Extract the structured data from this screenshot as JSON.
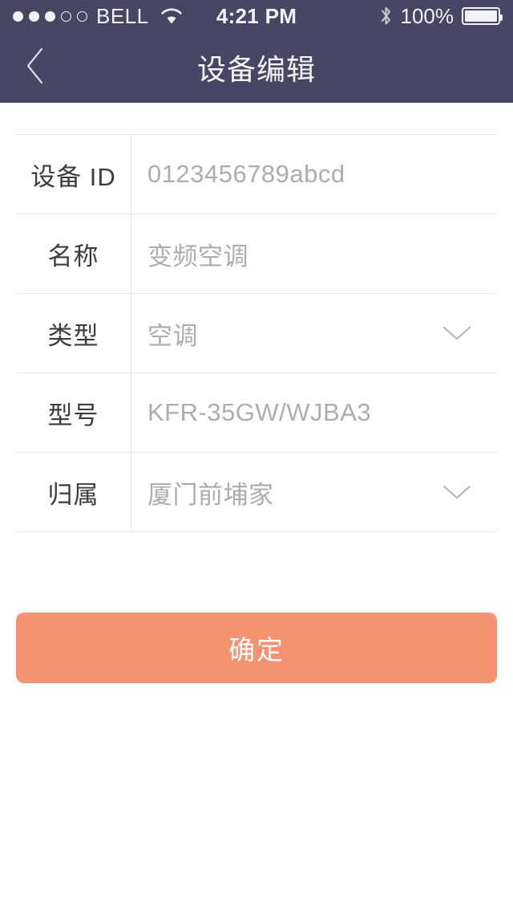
{
  "status_bar": {
    "signal_dots_filled": 3,
    "signal_dots_total": 5,
    "carrier": "BELL",
    "wifi_icon": "wifi-icon",
    "time": "4:21 PM",
    "bluetooth_icon": "bluetooth-icon",
    "battery_percent": "100%",
    "battery_level": 100,
    "background_color": "#474663",
    "foreground_color": "#F2F2F5"
  },
  "nav_bar": {
    "back_icon": "chevron-left-icon",
    "title": "设备编辑",
    "background_color": "#474663",
    "title_color": "#F4F4F7"
  },
  "form": {
    "rows": [
      {
        "label": "设备 ID",
        "value": "0123456789abcd",
        "has_dropdown": false,
        "name": "device-id"
      },
      {
        "label": "名称",
        "value": "变频空调",
        "has_dropdown": false,
        "name": "device-name"
      },
      {
        "label": "类型",
        "value": "空调",
        "has_dropdown": true,
        "name": "device-type"
      },
      {
        "label": "型号",
        "value": "KFR-35GW/WJBA3",
        "has_dropdown": false,
        "name": "device-model"
      },
      {
        "label": "归属",
        "value": "厦门前埔家",
        "has_dropdown": true,
        "name": "device-owner"
      }
    ],
    "label_color": "#3C3C3C",
    "value_color": "#ADADAD",
    "divider_color": "#E6E6E6"
  },
  "confirm_button": {
    "label": "确定",
    "background_color": "#F59272",
    "text_color": "#FFFFFF"
  }
}
